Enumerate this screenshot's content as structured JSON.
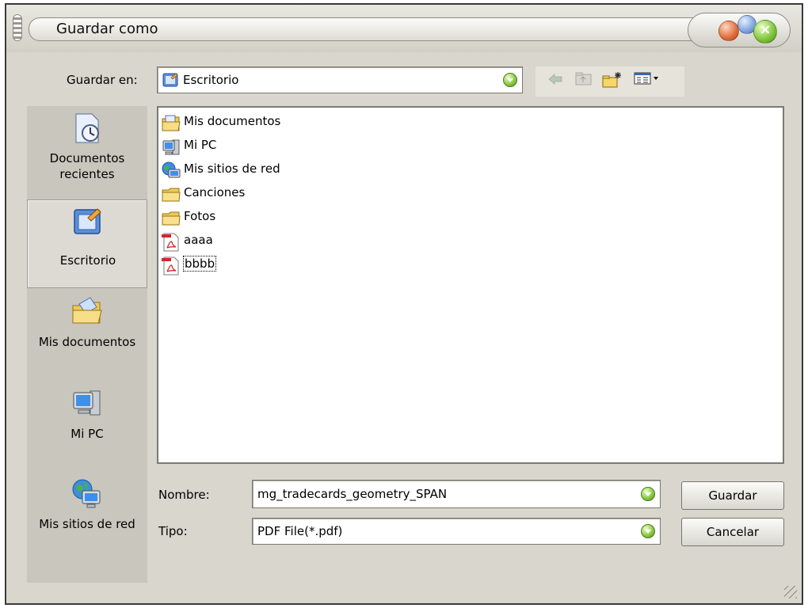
{
  "window": {
    "title": "Guardar como"
  },
  "save_in": {
    "label": "Guardar en:",
    "value": "Escritorio",
    "icon": "desktop-icon"
  },
  "toolbar": {
    "buttons": [
      "back-arrow-icon",
      "up-folder-icon",
      "new-folder-icon",
      "view-menu-icon"
    ]
  },
  "places": [
    {
      "label": "Documentos recientes",
      "icon": "recent-documents-icon"
    },
    {
      "label": "Escritorio",
      "icon": "desktop-icon",
      "active": true
    },
    {
      "label": "Mis documentos",
      "icon": "my-documents-icon"
    },
    {
      "label": "Mi PC",
      "icon": "my-computer-icon"
    },
    {
      "label": "Mis sitios de red",
      "icon": "network-places-icon"
    }
  ],
  "files": [
    {
      "name": "Mis documentos",
      "icon": "my-documents-folder-icon"
    },
    {
      "name": "Mi PC",
      "icon": "my-computer-icon"
    },
    {
      "name": "Mis sitios de red",
      "icon": "network-places-icon"
    },
    {
      "name": "Canciones",
      "icon": "folder-icon"
    },
    {
      "name": "Fotos",
      "icon": "folder-icon"
    },
    {
      "name": "aaaa",
      "icon": "pdf-file-icon"
    },
    {
      "name": "bbbb",
      "icon": "pdf-file-icon",
      "focused": true
    }
  ],
  "filename": {
    "label": "Nombre:",
    "value": "mg_tradecards_geometry_SPAN"
  },
  "filetype": {
    "label": "Tipo:",
    "value": "PDF File(*.pdf)"
  },
  "buttons": {
    "save": "Guardar",
    "cancel": "Cancelar"
  }
}
